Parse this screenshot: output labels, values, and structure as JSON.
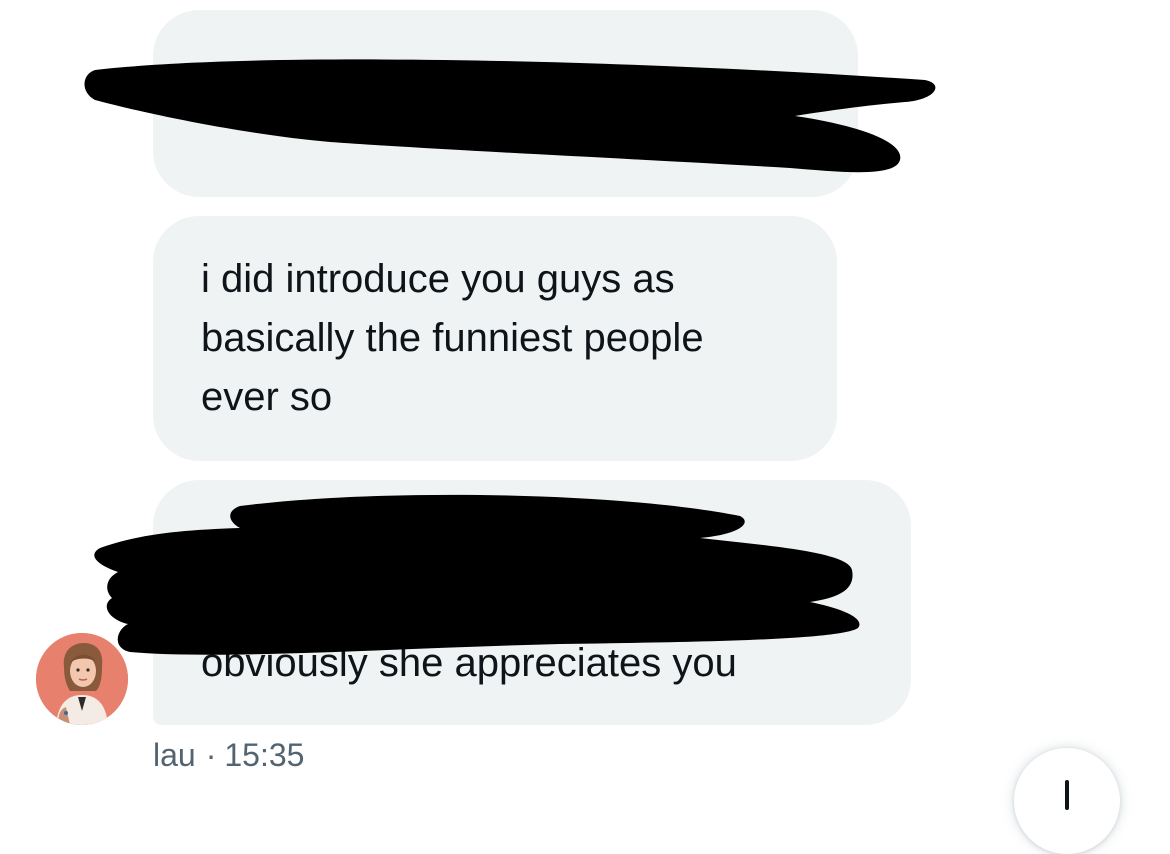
{
  "conversation": {
    "messages": [
      {
        "text": "",
        "redacted": true
      },
      {
        "text": "i did introduce you guys as\nbasically the funniest people\never so",
        "redacted": false
      },
      {
        "text": "obviously she appreciates you",
        "redacted": true
      }
    ],
    "sender_name": "lau",
    "separator": "·",
    "timestamp": "15:35"
  },
  "icons": {
    "scroll": "arrow-down-icon"
  },
  "colors": {
    "bubble": "#eff3f4",
    "text": "#0f1419",
    "meta": "#536471",
    "redaction": "#000000"
  }
}
